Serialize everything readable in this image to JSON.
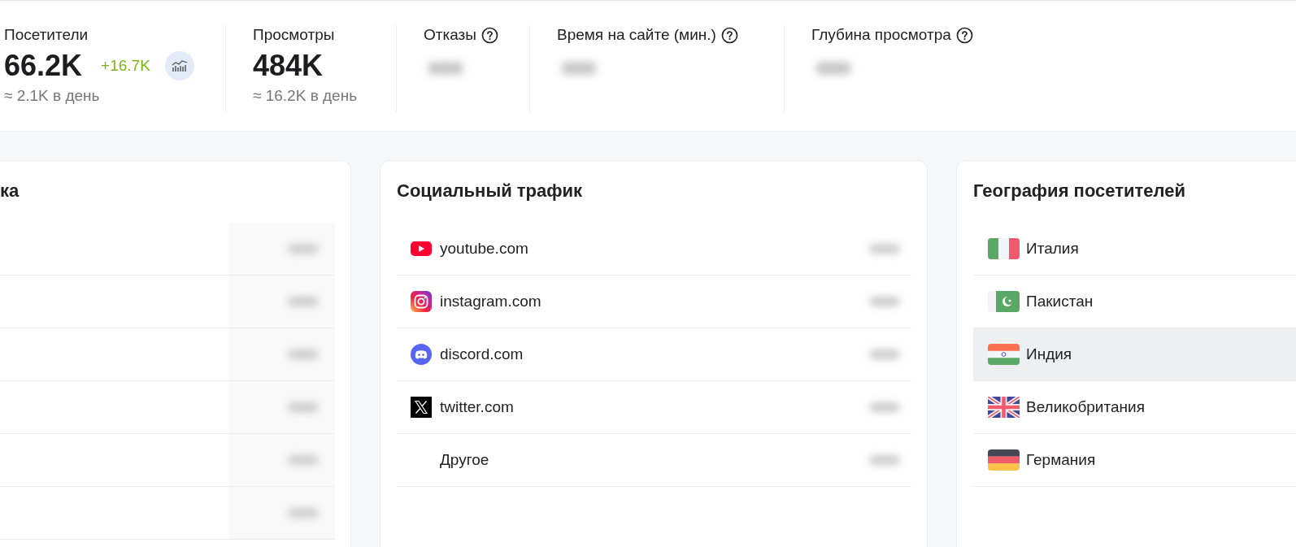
{
  "stats": [
    {
      "label": "Посетители",
      "value": "66.2K",
      "delta": "+16.7K",
      "chart_button": true,
      "per_day": "≈ 2.1K в день"
    },
    {
      "label": "Просмотры",
      "value": "484K",
      "per_day": "≈ 16.2K в день"
    },
    {
      "label": "Отказы",
      "help": true,
      "value_blurred": true
    },
    {
      "label": "Время на сайте (мин.)",
      "help": true,
      "value_blurred": true
    },
    {
      "label": "Глубина просмотра",
      "help": true,
      "value_blurred": true
    }
  ],
  "cards": [
    {
      "title": "ка",
      "kind": "plain",
      "rows": [
        {
          "value_blurred": true
        },
        {
          "value_blurred": true
        },
        {
          "value_blurred": true
        },
        {
          "value_blurred": true
        },
        {
          "value_blurred": true
        },
        {
          "value_blurred": true
        }
      ]
    },
    {
      "title": "Социальный трафик",
      "kind": "social",
      "rows": [
        {
          "name": "youtube.com",
          "value_blurred": true
        },
        {
          "name": "instagram.com",
          "value_blurred": true
        },
        {
          "name": "discord.com",
          "value_blurred": true
        },
        {
          "name": "twitter.com",
          "value_blurred": true
        },
        {
          "name": "Другое",
          "value_blurred": true
        }
      ]
    },
    {
      "title": "География посетителей",
      "kind": "geo",
      "rows": [
        {
          "name": "Италия",
          "highlighted": false
        },
        {
          "name": "Пакистан",
          "highlighted": false
        },
        {
          "name": "Индия",
          "highlighted": true
        },
        {
          "name": "Великобритания",
          "highlighted": false
        },
        {
          "name": "Германия",
          "highlighted": false
        }
      ]
    }
  ]
}
